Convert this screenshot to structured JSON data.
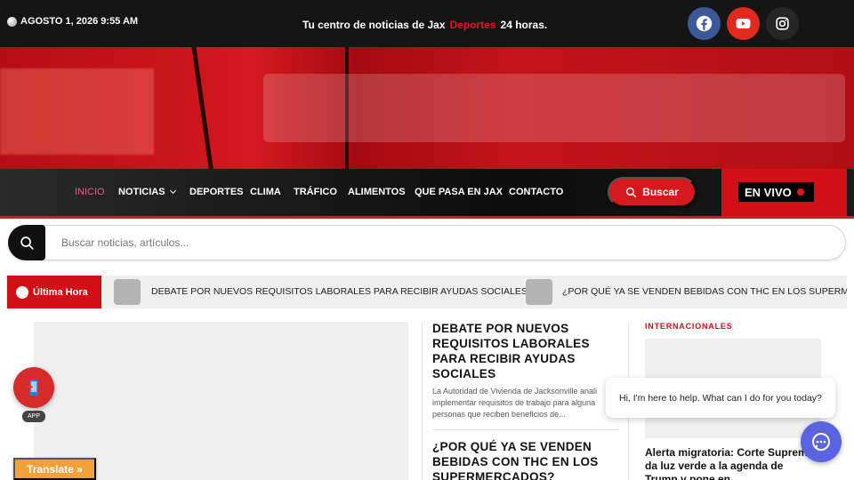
{
  "topbar": {
    "datetime": "AGOSTO 1, 2026 9:55 AM",
    "tagline_pre": "Tu centro de noticias de Jax",
    "tagline_highlight": "Deportes",
    "tagline_post": "24 horas.",
    "social": [
      {
        "name": "facebook-icon",
        "color": "#3b5998"
      },
      {
        "name": "youtube-icon",
        "color": "#e02a20"
      },
      {
        "name": "instagram-icon",
        "color": "#262626"
      }
    ]
  },
  "nav": {
    "items": [
      "INICIO",
      "NOTICIAS",
      "DEPORTES",
      "CLIMA",
      "TRÁFICO",
      "ALIMENTOS",
      "QUE PASA EN JAX",
      "CONTACTO"
    ],
    "search_button": "Buscar",
    "live": "EN VIVO",
    "accent": "#d00f17"
  },
  "search": {
    "placeholder": "Buscar noticias, artículos..."
  },
  "breaking": {
    "label": "Última Hora",
    "items": [
      "DEBATE POR NUEVOS REQUISITOS LABORALES PARA RECIBIR AYUDAS SOCIALES",
      "¿POR QUÉ YA SE VENDEN BEBIDAS CON THC EN LOS SUPERMERCADOS?"
    ]
  },
  "articles": [
    {
      "title": "DEBATE POR NUEVOS REQUISITOS LABORALES PARA RECIBIR AYUDAS SOCIALES",
      "excerpt": "La Autoridad de Vivienda de Jacksonville anali implementar requisitos de trabajo para alguna personas que reciben beneficios de..."
    },
    {
      "title": "¿POR QUÉ YA SE VENDEN BEBIDAS CON THC EN LOS SUPERMERCADOS?"
    }
  ],
  "sidebar": {
    "category": "INTERNACIONALES",
    "title": "Alerta migratoria: Corte Suprema da luz verde a la agenda de Trump y pone en"
  },
  "floating": {
    "app_label": "APP",
    "translate": "Translate »",
    "chat_message": "Hi, I'm here to help. What can I do for you today?"
  }
}
